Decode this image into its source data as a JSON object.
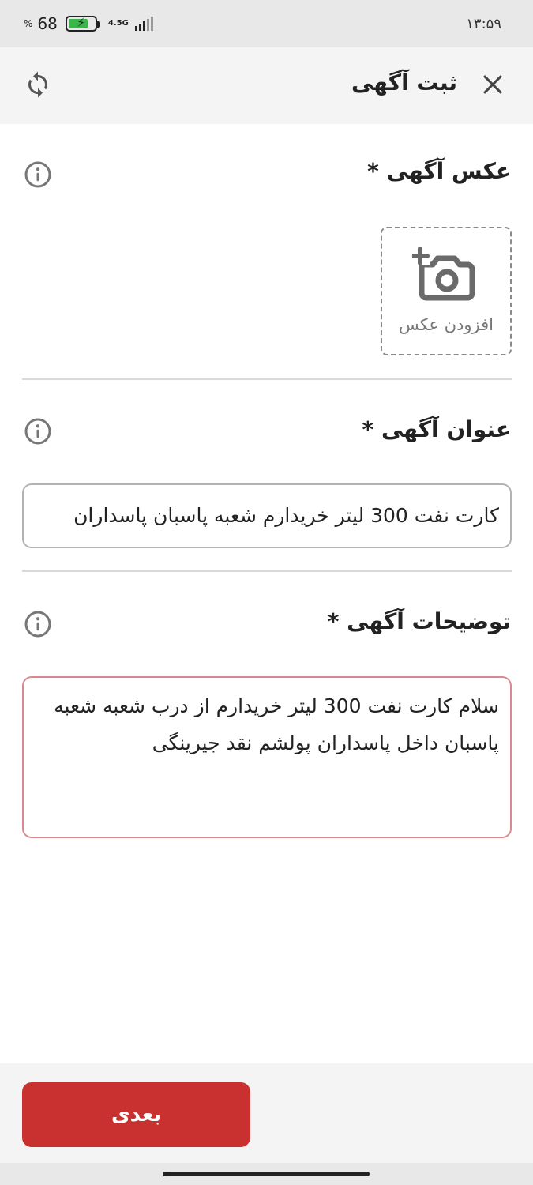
{
  "status_bar": {
    "time": "۱۳:۵۹",
    "battery_level": "68",
    "percent_sign": "%",
    "network": "4.5G"
  },
  "header": {
    "title": "ثبت آگهی",
    "close_icon": "close-icon",
    "refresh_icon": "refresh-icon"
  },
  "sections": {
    "photo": {
      "title": "عکس آگهی *",
      "add_photo_label": "افزودن عکس"
    },
    "title": {
      "label": "عنوان آگهی *",
      "value": "کارت نفت 300 لیتر خریدارم شعبه پاسبان پاسداران"
    },
    "description": {
      "label": "توضیحات آگهی *",
      "value": "سلام کارت نفت 300 لیتر خریدارم از درب شعبه شعبه پاسبان داخل پاسداران پولشم نقد جیرینگی"
    }
  },
  "footer": {
    "next_label": "بعدی"
  },
  "colors": {
    "primary": "#c93030",
    "error_border": "#d98a8f"
  }
}
